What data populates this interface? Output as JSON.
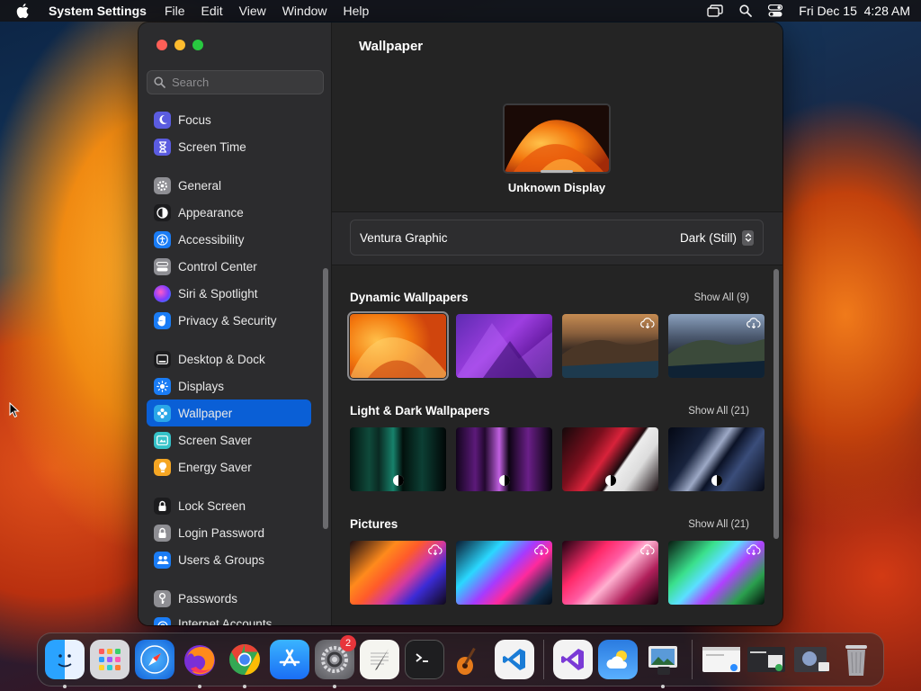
{
  "menubar": {
    "app_name": "System Settings",
    "menus": [
      "File",
      "Edit",
      "View",
      "Window",
      "Help"
    ],
    "clock": "Fri Dec 15  4:28 AM"
  },
  "sidebar": {
    "search_placeholder": "Search",
    "items": [
      {
        "label": "Focus",
        "icon": "moon-icon",
        "color": "#5b5ce0"
      },
      {
        "label": "Screen Time",
        "icon": "hourglass-icon",
        "color": "#5b5ce0"
      },
      {
        "label": "General",
        "icon": "gear-icon",
        "color": "#8e8e93"
      },
      {
        "label": "Appearance",
        "icon": "appearance-icon",
        "color": "#1c1c1e"
      },
      {
        "label": "Accessibility",
        "icon": "accessibility-icon",
        "color": "#1a7cf5"
      },
      {
        "label": "Control Center",
        "icon": "control-center-icon",
        "color": "#8e8e93"
      },
      {
        "label": "Siri & Spotlight",
        "icon": "siri-icon",
        "color": "#c03ce0"
      },
      {
        "label": "Privacy & Security",
        "icon": "hand-icon",
        "color": "#1a7cf5"
      },
      {
        "label": "Desktop & Dock",
        "icon": "desktop-icon",
        "color": "#1c1c1e"
      },
      {
        "label": "Displays",
        "icon": "sun-icon",
        "color": "#1a7cf5"
      },
      {
        "label": "Wallpaper",
        "icon": "wallpaper-icon",
        "color": "#2aa7e8"
      },
      {
        "label": "Screen Saver",
        "icon": "screen-saver-icon",
        "color": "#36c2c8"
      },
      {
        "label": "Energy Saver",
        "icon": "lightbulb-icon",
        "color": "#f5a623"
      },
      {
        "label": "Lock Screen",
        "icon": "lock-icon",
        "color": "#1c1c1e"
      },
      {
        "label": "Login Password",
        "icon": "key-lock-icon",
        "color": "#8e8e93"
      },
      {
        "label": "Users & Groups",
        "icon": "users-icon",
        "color": "#1a7cf5"
      },
      {
        "label": "Passwords",
        "icon": "key-icon",
        "color": "#8e8e93"
      },
      {
        "label": "Internet Accounts",
        "icon": "at-icon",
        "color": "#1a7cf5"
      }
    ],
    "active": "Wallpaper"
  },
  "main": {
    "title": "Wallpaper",
    "display_name": "Unknown Display",
    "current_wallpaper": "Ventura Graphic",
    "current_style": "Dark (Still)",
    "sections": [
      {
        "title": "Dynamic Wallpapers",
        "show_all": "Show All (9)"
      },
      {
        "title": "Light & Dark Wallpapers",
        "show_all": "Show All (21)"
      },
      {
        "title": "Pictures",
        "show_all": "Show All (21)"
      }
    ]
  },
  "dock": {
    "apps": [
      "Finder",
      "Launchpad",
      "Safari",
      "Firefox",
      "Chrome",
      "App Store",
      "System Settings",
      "TextEdit",
      "Terminal",
      "GarageBand",
      "Visual Studio Code",
      "Visual Studio",
      "Weather",
      "Preview",
      "Trash"
    ],
    "system_settings_badge": "2"
  },
  "colors": {
    "accent": "#0a5fd6",
    "window_bg": "#242424",
    "sidebar_bg": "#2c2c2e"
  }
}
